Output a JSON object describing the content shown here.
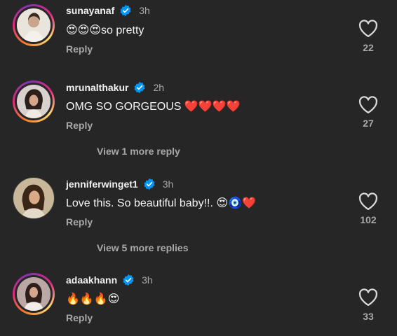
{
  "comments": [
    {
      "username": "sunayanaf",
      "time": "3h",
      "text": "😍😍😍so pretty",
      "reply": "Reply",
      "likes": "22",
      "avatar_ring": true
    },
    {
      "username": "mrunalthakur",
      "time": "2h",
      "text": "OMG SO GORGEOUS ❤️❤️❤️❤️",
      "reply": "Reply",
      "likes": "27",
      "avatar_ring": true
    },
    {
      "username": "jenniferwinget1",
      "time": "3h",
      "text": "Love this. So beautiful baby!!. 😍🧿❤️",
      "reply": "Reply",
      "likes": "102",
      "avatar_ring": false
    },
    {
      "username": "adaakhann",
      "time": "3h",
      "text": "🔥🔥🔥😍",
      "reply": "Reply",
      "likes": "33",
      "avatar_ring": true
    }
  ],
  "view_more": [
    "View 1 more reply",
    "View 5 more replies"
  ],
  "icons": {
    "verified": "verified-badge-icon",
    "like": "heart-outline-icon"
  },
  "colors": {
    "background": "#262626",
    "verified": "#0095f6",
    "muted": "#a8a8a8"
  }
}
